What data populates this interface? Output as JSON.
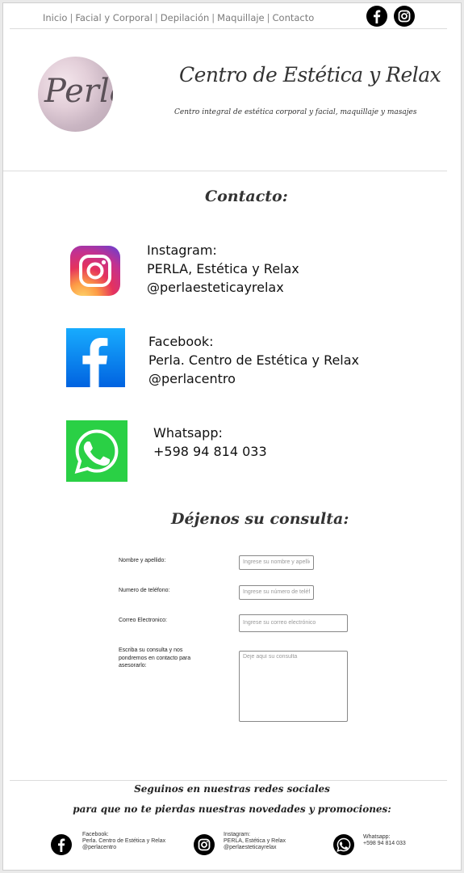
{
  "nav": {
    "items": [
      "Inicio",
      "Facial y Corporal",
      "Depilación",
      "Maquillaje",
      "Contacto"
    ],
    "separator": "|"
  },
  "header": {
    "logo_text": "Perla",
    "title": "Centro de Estética y Relax",
    "subtitle": "Centro integral de estética corporal y facial, maquillaje y masajes"
  },
  "contact": {
    "title": "Contacto:",
    "instagram": {
      "icon": "instagram-icon",
      "lines": [
        "Instagram:",
        "PERLA, Estética y Relax",
        "@perlaesteticayrelax"
      ]
    },
    "facebook": {
      "icon": "facebook-icon",
      "lines": [
        "Facebook:",
        "Perla. Centro de Estética y Relax",
        "@perlacentro"
      ]
    },
    "whatsapp": {
      "icon": "whatsapp-icon",
      "lines": [
        "Whatsapp:",
        "+598 94 814 033"
      ]
    }
  },
  "form": {
    "title": "Déjenos su consulta:",
    "name_label": "Nombre y apellido:",
    "name_placeholder": "Ingrese su nombre y apellido",
    "phone_label": "Numero de teléfono:",
    "phone_placeholder": "Ingrese su número de teléfono",
    "email_label": "Correo Electronico:",
    "email_placeholder": "Ingrese su correo electrónico",
    "message_label": "Escriba su consulta y nos pondremos en contacto para asesorarlo:",
    "message_placeholder": "Deje aquí su consulta"
  },
  "footer": {
    "title_line1": "Seguinos en nuestras redes sociales",
    "title_line2": "para que no te pierdas nuestras novedades y promociones:",
    "facebook": {
      "lines": [
        "Facebook:",
        "Perla. Centro de Estética y Relax",
        "@perlacentro"
      ]
    },
    "instagram": {
      "lines": [
        "Instagram:",
        "PERLA, Estética y Relax",
        "@perlaesteticayrelax"
      ]
    },
    "whatsapp": {
      "lines": [
        "Whatsapp:",
        "+598 94 814 033"
      ]
    }
  },
  "colors": {
    "facebook": "#1877f2",
    "whatsapp": "#25d366",
    "nav_text": "#7b7b7b"
  }
}
